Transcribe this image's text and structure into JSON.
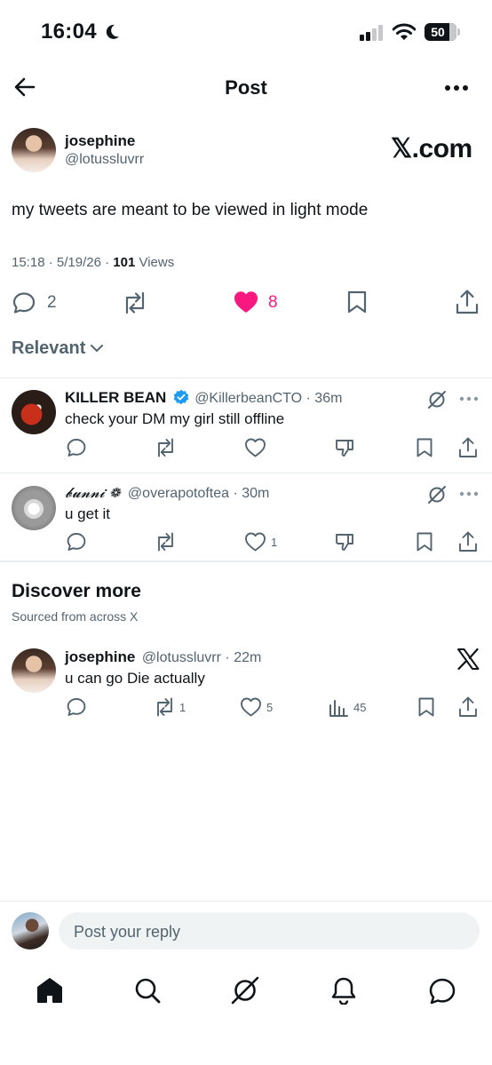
{
  "status_bar": {
    "time": "16:04",
    "battery": "50"
  },
  "header": {
    "title": "Post"
  },
  "post": {
    "author_name": "josephine",
    "author_handle": "@lotussluvrr",
    "source_badge": "𝕏.com",
    "text": "my tweets are meant to be viewed in light mode",
    "time": "15:18",
    "date": "5/19/26",
    "views_count": "101",
    "views_label": "Views",
    "reply_count": "2",
    "like_count": "8"
  },
  "sort": {
    "label": "Relevant"
  },
  "replies": [
    {
      "name": "KILLER BEAN",
      "verified": true,
      "handle": "@KillerbeanCTO",
      "time": "36m",
      "text": "check your DM my girl still offline",
      "like_count": ""
    },
    {
      "name": "𝓫𝓾𝓷𝓷𝓲 ❁",
      "handle": "@overapotoftea",
      "time": "30m",
      "text": "u get it",
      "like_count": "1"
    }
  ],
  "discover": {
    "title": "Discover more",
    "subtitle": "Sourced from across X",
    "post": {
      "name": "josephine",
      "handle": "@lotussluvrr",
      "time": "22m",
      "text": "u can go Die actually",
      "retweet_count": "1",
      "like_count": "5",
      "view_count": "45"
    }
  },
  "composer": {
    "placeholder": "Post your reply"
  },
  "colors": {
    "like": "#f91880",
    "verified": "#1d9bf0",
    "secondary": "#536471"
  },
  "icons": [
    "back-arrow-icon",
    "more-icon",
    "reply-icon",
    "retweet-icon",
    "heart-icon",
    "bookmark-icon",
    "share-icon",
    "chevron-down-icon",
    "grok-icon",
    "dislike-icon",
    "analytics-icon",
    "x-logo-icon",
    "home-icon",
    "search-icon",
    "notifications-icon",
    "messages-icon"
  ]
}
